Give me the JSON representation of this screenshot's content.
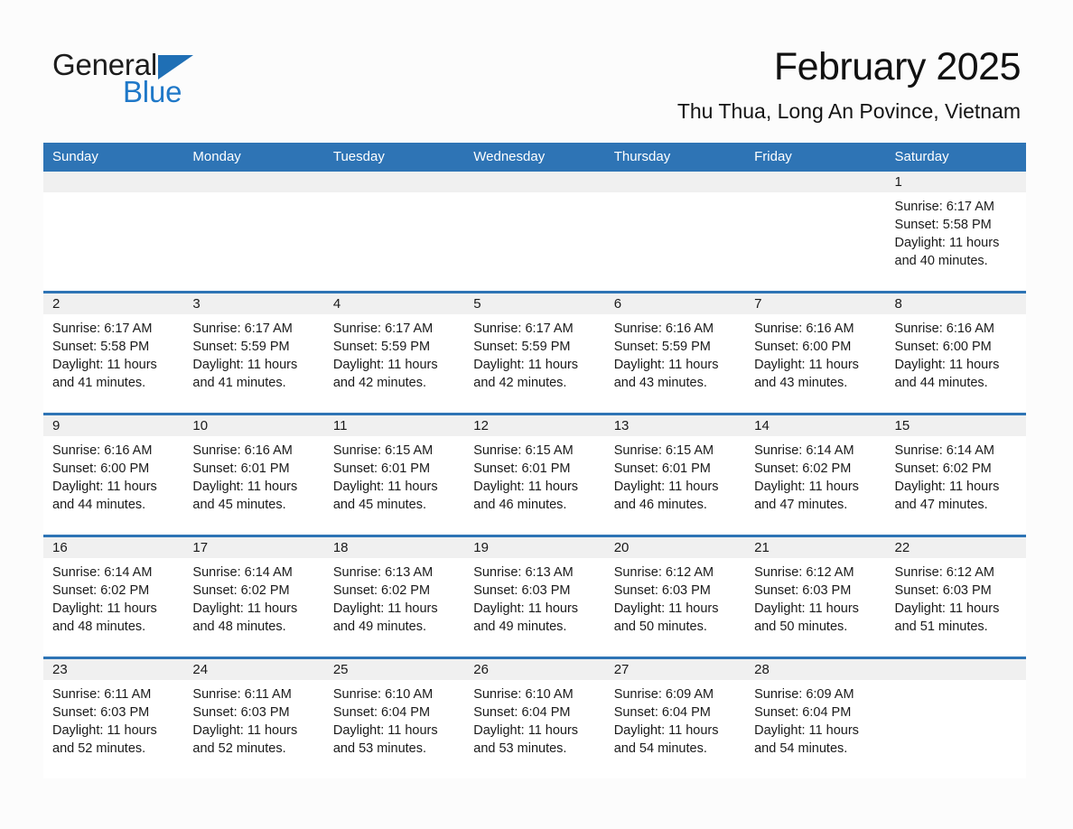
{
  "brand": {
    "name_part1": "General",
    "name_part2": "Blue",
    "triangle_color": "#1f6fb5",
    "blue_text_color": "#1f78c8"
  },
  "header": {
    "title": "February 2025",
    "subtitle": "Thu Thua, Long An Povince, Vietnam"
  },
  "theme": {
    "header_blue": "#2e74b5",
    "day_band_gray": "#f0f0f0",
    "page_background": "#fcfcfc"
  },
  "weekday_headers": [
    "Sunday",
    "Monday",
    "Tuesday",
    "Wednesday",
    "Thursday",
    "Friday",
    "Saturday"
  ],
  "weeks": [
    [
      {
        "day": "",
        "sunrise": "",
        "sunset": "",
        "daylight_line1": "",
        "daylight_line2": ""
      },
      {
        "day": "",
        "sunrise": "",
        "sunset": "",
        "daylight_line1": "",
        "daylight_line2": ""
      },
      {
        "day": "",
        "sunrise": "",
        "sunset": "",
        "daylight_line1": "",
        "daylight_line2": ""
      },
      {
        "day": "",
        "sunrise": "",
        "sunset": "",
        "daylight_line1": "",
        "daylight_line2": ""
      },
      {
        "day": "",
        "sunrise": "",
        "sunset": "",
        "daylight_line1": "",
        "daylight_line2": ""
      },
      {
        "day": "",
        "sunrise": "",
        "sunset": "",
        "daylight_line1": "",
        "daylight_line2": ""
      },
      {
        "day": "1",
        "sunrise": "Sunrise: 6:17 AM",
        "sunset": "Sunset: 5:58 PM",
        "daylight_line1": "Daylight: 11 hours",
        "daylight_line2": "and 40 minutes."
      }
    ],
    [
      {
        "day": "2",
        "sunrise": "Sunrise: 6:17 AM",
        "sunset": "Sunset: 5:58 PM",
        "daylight_line1": "Daylight: 11 hours",
        "daylight_line2": "and 41 minutes."
      },
      {
        "day": "3",
        "sunrise": "Sunrise: 6:17 AM",
        "sunset": "Sunset: 5:59 PM",
        "daylight_line1": "Daylight: 11 hours",
        "daylight_line2": "and 41 minutes."
      },
      {
        "day": "4",
        "sunrise": "Sunrise: 6:17 AM",
        "sunset": "Sunset: 5:59 PM",
        "daylight_line1": "Daylight: 11 hours",
        "daylight_line2": "and 42 minutes."
      },
      {
        "day": "5",
        "sunrise": "Sunrise: 6:17 AM",
        "sunset": "Sunset: 5:59 PM",
        "daylight_line1": "Daylight: 11 hours",
        "daylight_line2": "and 42 minutes."
      },
      {
        "day": "6",
        "sunrise": "Sunrise: 6:16 AM",
        "sunset": "Sunset: 5:59 PM",
        "daylight_line1": "Daylight: 11 hours",
        "daylight_line2": "and 43 minutes."
      },
      {
        "day": "7",
        "sunrise": "Sunrise: 6:16 AM",
        "sunset": "Sunset: 6:00 PM",
        "daylight_line1": "Daylight: 11 hours",
        "daylight_line2": "and 43 minutes."
      },
      {
        "day": "8",
        "sunrise": "Sunrise: 6:16 AM",
        "sunset": "Sunset: 6:00 PM",
        "daylight_line1": "Daylight: 11 hours",
        "daylight_line2": "and 44 minutes."
      }
    ],
    [
      {
        "day": "9",
        "sunrise": "Sunrise: 6:16 AM",
        "sunset": "Sunset: 6:00 PM",
        "daylight_line1": "Daylight: 11 hours",
        "daylight_line2": "and 44 minutes."
      },
      {
        "day": "10",
        "sunrise": "Sunrise: 6:16 AM",
        "sunset": "Sunset: 6:01 PM",
        "daylight_line1": "Daylight: 11 hours",
        "daylight_line2": "and 45 minutes."
      },
      {
        "day": "11",
        "sunrise": "Sunrise: 6:15 AM",
        "sunset": "Sunset: 6:01 PM",
        "daylight_line1": "Daylight: 11 hours",
        "daylight_line2": "and 45 minutes."
      },
      {
        "day": "12",
        "sunrise": "Sunrise: 6:15 AM",
        "sunset": "Sunset: 6:01 PM",
        "daylight_line1": "Daylight: 11 hours",
        "daylight_line2": "and 46 minutes."
      },
      {
        "day": "13",
        "sunrise": "Sunrise: 6:15 AM",
        "sunset": "Sunset: 6:01 PM",
        "daylight_line1": "Daylight: 11 hours",
        "daylight_line2": "and 46 minutes."
      },
      {
        "day": "14",
        "sunrise": "Sunrise: 6:14 AM",
        "sunset": "Sunset: 6:02 PM",
        "daylight_line1": "Daylight: 11 hours",
        "daylight_line2": "and 47 minutes."
      },
      {
        "day": "15",
        "sunrise": "Sunrise: 6:14 AM",
        "sunset": "Sunset: 6:02 PM",
        "daylight_line1": "Daylight: 11 hours",
        "daylight_line2": "and 47 minutes."
      }
    ],
    [
      {
        "day": "16",
        "sunrise": "Sunrise: 6:14 AM",
        "sunset": "Sunset: 6:02 PM",
        "daylight_line1": "Daylight: 11 hours",
        "daylight_line2": "and 48 minutes."
      },
      {
        "day": "17",
        "sunrise": "Sunrise: 6:14 AM",
        "sunset": "Sunset: 6:02 PM",
        "daylight_line1": "Daylight: 11 hours",
        "daylight_line2": "and 48 minutes."
      },
      {
        "day": "18",
        "sunrise": "Sunrise: 6:13 AM",
        "sunset": "Sunset: 6:02 PM",
        "daylight_line1": "Daylight: 11 hours",
        "daylight_line2": "and 49 minutes."
      },
      {
        "day": "19",
        "sunrise": "Sunrise: 6:13 AM",
        "sunset": "Sunset: 6:03 PM",
        "daylight_line1": "Daylight: 11 hours",
        "daylight_line2": "and 49 minutes."
      },
      {
        "day": "20",
        "sunrise": "Sunrise: 6:12 AM",
        "sunset": "Sunset: 6:03 PM",
        "daylight_line1": "Daylight: 11 hours",
        "daylight_line2": "and 50 minutes."
      },
      {
        "day": "21",
        "sunrise": "Sunrise: 6:12 AM",
        "sunset": "Sunset: 6:03 PM",
        "daylight_line1": "Daylight: 11 hours",
        "daylight_line2": "and 50 minutes."
      },
      {
        "day": "22",
        "sunrise": "Sunrise: 6:12 AM",
        "sunset": "Sunset: 6:03 PM",
        "daylight_line1": "Daylight: 11 hours",
        "daylight_line2": "and 51 minutes."
      }
    ],
    [
      {
        "day": "23",
        "sunrise": "Sunrise: 6:11 AM",
        "sunset": "Sunset: 6:03 PM",
        "daylight_line1": "Daylight: 11 hours",
        "daylight_line2": "and 52 minutes."
      },
      {
        "day": "24",
        "sunrise": "Sunrise: 6:11 AM",
        "sunset": "Sunset: 6:03 PM",
        "daylight_line1": "Daylight: 11 hours",
        "daylight_line2": "and 52 minutes."
      },
      {
        "day": "25",
        "sunrise": "Sunrise: 6:10 AM",
        "sunset": "Sunset: 6:04 PM",
        "daylight_line1": "Daylight: 11 hours",
        "daylight_line2": "and 53 minutes."
      },
      {
        "day": "26",
        "sunrise": "Sunrise: 6:10 AM",
        "sunset": "Sunset: 6:04 PM",
        "daylight_line1": "Daylight: 11 hours",
        "daylight_line2": "and 53 minutes."
      },
      {
        "day": "27",
        "sunrise": "Sunrise: 6:09 AM",
        "sunset": "Sunset: 6:04 PM",
        "daylight_line1": "Daylight: 11 hours",
        "daylight_line2": "and 54 minutes."
      },
      {
        "day": "28",
        "sunrise": "Sunrise: 6:09 AM",
        "sunset": "Sunset: 6:04 PM",
        "daylight_line1": "Daylight: 11 hours",
        "daylight_line2": "and 54 minutes."
      },
      {
        "day": "",
        "sunrise": "",
        "sunset": "",
        "daylight_line1": "",
        "daylight_line2": ""
      }
    ]
  ]
}
